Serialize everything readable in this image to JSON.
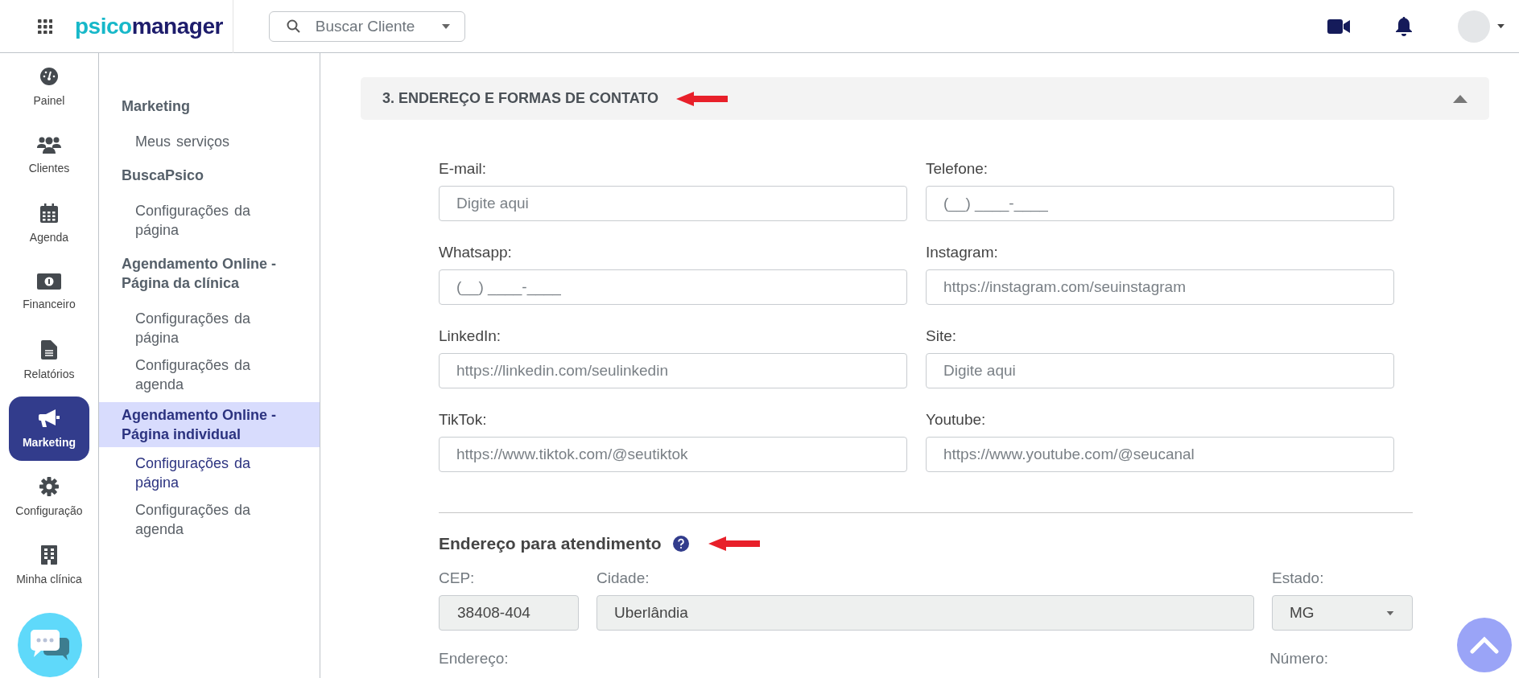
{
  "topbar": {
    "logo_lead": "psico",
    "logo_tail": "manager",
    "search": {
      "placeholder": "Buscar Cliente"
    }
  },
  "rail": [
    {
      "label": "Painel",
      "selected": false
    },
    {
      "label": "Clientes",
      "selected": false
    },
    {
      "label": "Agenda",
      "selected": false
    },
    {
      "label": "Financeiro",
      "selected": false
    },
    {
      "label": "Relatórios",
      "selected": false
    },
    {
      "label": "Marketing",
      "selected": true
    },
    {
      "label": "Configuração",
      "selected": false
    },
    {
      "label": "Minha clínica",
      "selected": false
    }
  ],
  "submenu": [
    {
      "title": "Marketing",
      "selected": false,
      "items": [
        {
          "label": "Meus serviços",
          "selected": false
        }
      ]
    },
    {
      "title": "BuscaPsico",
      "selected": false,
      "items": [
        {
          "label": "Configurações da página",
          "selected": false
        }
      ]
    },
    {
      "title": "Agendamento Online - Página da clínica",
      "selected": false,
      "items": [
        {
          "label": "Configurações da página",
          "selected": false
        },
        {
          "label": "Configurações da agenda",
          "selected": false
        }
      ]
    },
    {
      "title": "Agendamento Online - Página individual",
      "selected": true,
      "items": [
        {
          "label": "Configurações da página",
          "selected": true
        },
        {
          "label": "Configurações da agenda",
          "selected": false
        }
      ]
    }
  ],
  "section": {
    "title": "3. ENDEREÇO E FORMAS DE CONTATO",
    "expanded": true,
    "fields": [
      {
        "label": "E-mail:",
        "placeholder": "Digite aqui"
      },
      {
        "label": "Telefone:",
        "placeholder": "(__) ____-____"
      },
      {
        "label": "Whatsapp:",
        "placeholder": "(__) ____-____"
      },
      {
        "label": "Instagram:",
        "placeholder": "https://instagram.com/seuinstagram"
      },
      {
        "label": "LinkedIn:",
        "placeholder": "https://linkedin.com/seulinkedin"
      },
      {
        "label": "Site:",
        "placeholder": "Digite aqui"
      },
      {
        "label": "TikTok:",
        "placeholder": "https://www.tiktok.com/@seutiktok"
      },
      {
        "label": "Youtube:",
        "placeholder": "https://www.youtube.com/@seucanal"
      }
    ],
    "address": {
      "title": "Endereço para atendimento",
      "fields": [
        {
          "label": "CEP:",
          "value": "38408-404",
          "kind": "text",
          "disabled": true
        },
        {
          "label": "Cidade:",
          "value": "Uberlândia",
          "kind": "text",
          "disabled": true
        },
        {
          "label": "Estado:",
          "value": "MG",
          "kind": "select",
          "disabled": true
        }
      ],
      "next_labels": [
        "Endereço:",
        "Número:"
      ]
    }
  }
}
